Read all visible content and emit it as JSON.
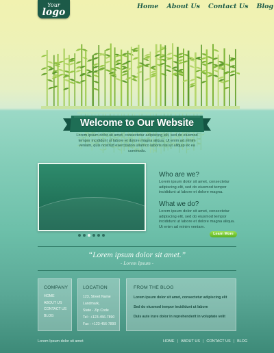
{
  "header": {
    "logo_line1": "Your",
    "logo_line2": "logo",
    "nav": [
      "Home",
      "About Us",
      "Contact Us",
      "Blog"
    ]
  },
  "hero": {
    "title": "Welcome to Our Website",
    "text": "Lorem ipsum dolor sit amet, consectetur adipiscing elit, sed do eiusmod tempor incididunt ut labore et dolore magna aliqua. Ut enim ad minim veniam, quis nostrud exercitation ullamco laboris nisi ut aliquip ex ea commodo."
  },
  "slider": {
    "dots": 6,
    "active_dot": 2
  },
  "who": {
    "heading": "Who are we?",
    "text": "Lorem ipsum dolor sit amet, consectetur adipiscing elit, sed do eiusmod tempor incididunt ut labore et dolore magna."
  },
  "what": {
    "heading": "What we do?",
    "text": "Lorem ipsum dolor sit amet, consectetur adipiscing elit, sed do eiusmod tempor incididunt ut labore et dolore magna aliqua. Ut enim ad minim veniam.",
    "button": "Learn More"
  },
  "quote": {
    "text": "“Lorem ipsum dolor sit amet.”",
    "author": "- Lorem Ipsum -"
  },
  "footer": {
    "company": {
      "heading": "COMPANY",
      "links": [
        "HOME",
        "ABOUT US",
        "CONTACT US",
        "BLOG"
      ]
    },
    "location": {
      "heading": "LOCATION",
      "lines": [
        "123, Street Name",
        "Landmark,",
        "State - Zip Code",
        "Tel : +123-456-7890",
        "Fax : +123-456-7890"
      ]
    },
    "blog": {
      "heading": "FROM THE BLOG",
      "items": [
        "Lorem ipsum dolor sit amet, consectetur adipiscing elit",
        "Sed do eiusmod tempor incididunt ut labore",
        "Duis aute irure dolor in reprehenderit in voluptate velit"
      ]
    },
    "copyright": "Lorem Ipsum dolor sit amet",
    "bottom_nav": [
      "HOME",
      "ABOUT US",
      "CONTACT US",
      "BLOG"
    ]
  },
  "colors": {
    "brand_dark": "#1c5a48",
    "ribbon": "#1e6e55",
    "button": "#6cc22e"
  }
}
